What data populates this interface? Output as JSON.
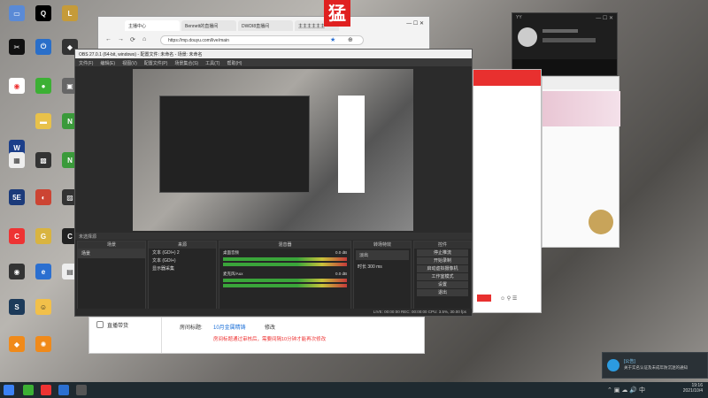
{
  "browser": {
    "tabs": [
      "主播中心",
      "Bennett的直播间",
      "DWDI8直播间",
      "主主主主主主",
      "猛"
    ],
    "address": "https://mp.douyu.com/live/main"
  },
  "overlay_glyph": "猛",
  "obs": {
    "title": "OBS 27.0.1 (64-bit, windows) - 配置文件: 未命名 - 场景: 未命名",
    "menu": [
      "文件(F)",
      "编辑(E)",
      "视图(V)",
      "配置文件(P)",
      "场景集合(S)",
      "工具(T)",
      "帮助(H)"
    ],
    "no_source": "未选择源",
    "docks": {
      "scenes": {
        "title": "场景",
        "items": [
          "场景"
        ]
      },
      "sources": {
        "title": "来源",
        "items": [
          "文本 (GDI+) 2",
          "文本 (GDI+)",
          "显示器采集"
        ]
      },
      "mixer": {
        "title": "混音器",
        "tracks": [
          {
            "name": "桌面音频",
            "db": "0.0 dB"
          },
          {
            "name": "麦克风/Aux",
            "db": "0.0 dB"
          }
        ]
      },
      "transitions": {
        "title": "转场特效",
        "type": "淡出",
        "duration_label": "时长",
        "duration": "300 ms"
      },
      "controls": {
        "title": "控件",
        "buttons": [
          "停止推流",
          "开始录制",
          "启动虚拟摄像机",
          "工作室模式",
          "设置",
          "退出"
        ]
      }
    },
    "status": "LIVE: 00:00:00  REC: 00:00:00  CPU: 3.5%, 30.00 fps"
  },
  "douyu_panel": {
    "section": "直播带货",
    "room_title_label": "房间标题:",
    "room_title": "10月金属精铸",
    "edit": "修改",
    "notice": "房间标题通过审核后，需要间隔10分钟才能再次修改"
  },
  "notification": {
    "title": "[公告]",
    "text": "关于实名认证及未成年防沉迷的通知"
  },
  "clock": {
    "time": "19:16",
    "date": "2021/10/4"
  }
}
